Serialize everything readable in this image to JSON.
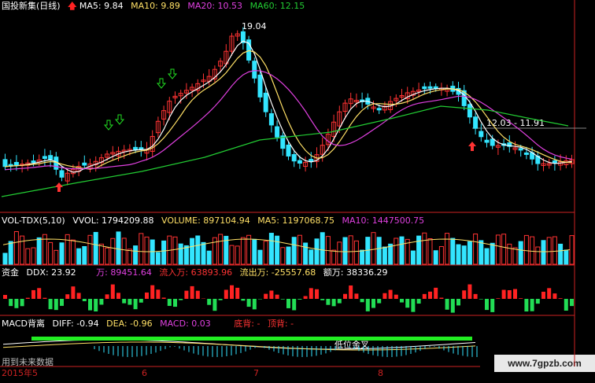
{
  "colors": {
    "up": "#ff3333",
    "down": "#33e5ff",
    "ma5": "#ffffff",
    "ma10": "#ffe066",
    "ma20": "#e040e0",
    "ma60": "#22cc33",
    "vol": "#ffffff",
    "volma5": "#ffe066",
    "volma10": "#e040e0",
    "ddx_up": "#ff2222",
    "ddx_down": "#22dd55",
    "macd_line": "#ffffff",
    "dea_line": "#ffe066",
    "axis": "#cc2222"
  },
  "main": {
    "stock_name": "国投新集(日线)",
    "ma5": "MA5: 9.84",
    "ma10": "MA10: 9.89",
    "ma20": "MA20: 10.53",
    "ma60": "MA60: 12.15",
    "peak_label": "19.04",
    "range_label": "12.03 - 11.91",
    "up_arrow_icon": "up-arrow-icon",
    "down_arrow_icon": "down-arrow-icon"
  },
  "volume": {
    "title": "VOL-TDX(5,10)",
    "vvol": "VVOL: 1794209.88",
    "volume": "VOLUME: 897104.94",
    "ma5": "MA5: 1197068.75",
    "ma10": "MA10: 1447500.75"
  },
  "ddx": {
    "title": "资金",
    "ddx": "DDX: 23.92",
    "wan": "万: 89451.64",
    "inflow": "流入万: 63893.96",
    "outflow": "流出万: -25557.68",
    "amount": "额万: 38336.29"
  },
  "macd": {
    "title": "MACD背离",
    "diff": "DIFF: -0.94",
    "dea": "DEA: -0.96",
    "macd": "MACD: 0.03",
    "bottom": "底背: -",
    "top": "顶背: -",
    "cross_label": "低位金叉",
    "future_label": "用到未来数据"
  },
  "axis": {
    "date_start": "2015年5",
    "m6": "6",
    "m7": "7",
    "m8": "8"
  },
  "watermark": "www.7gpzb.com"
}
